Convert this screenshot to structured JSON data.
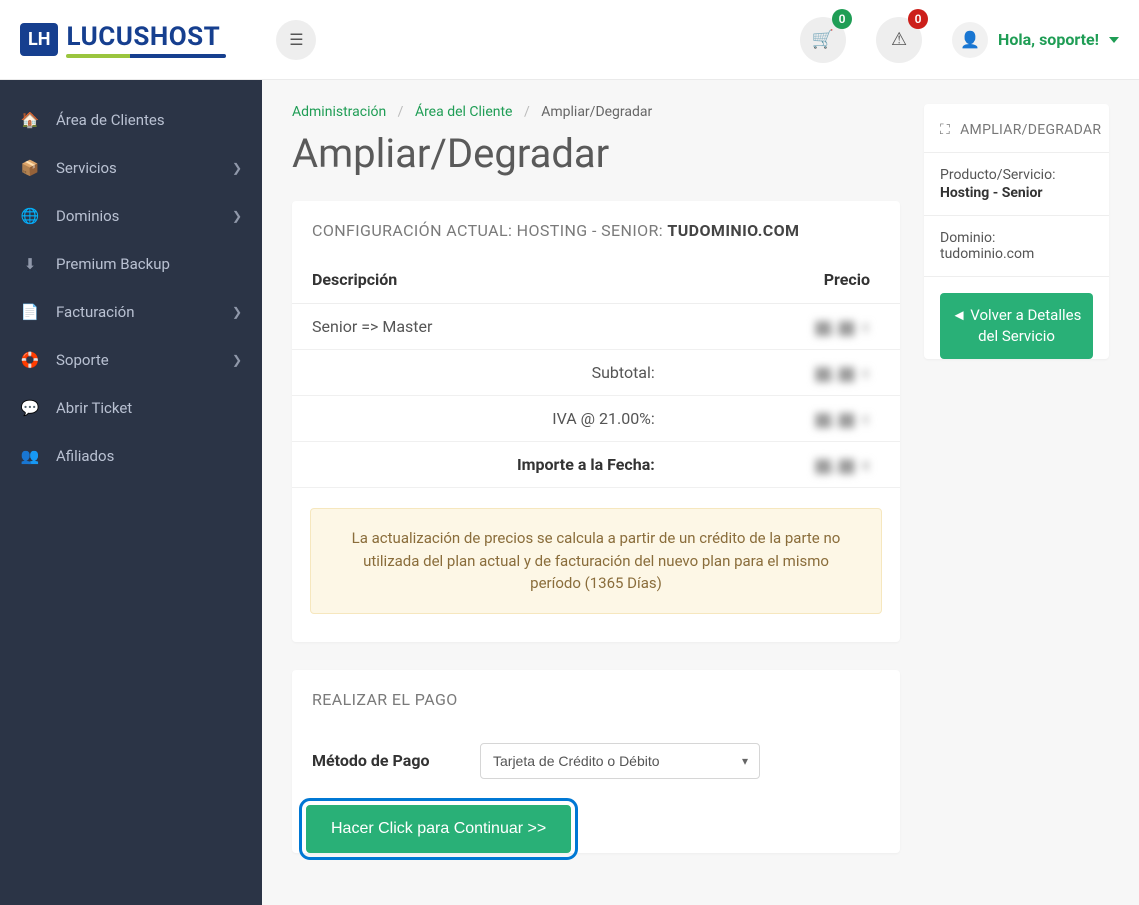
{
  "brand": {
    "badge": "LH",
    "name": "LUCUSHOST"
  },
  "topbar": {
    "cart_badge": "0",
    "alert_badge": "0",
    "greeting": "Hola, soporte!"
  },
  "sidebar": {
    "items": [
      {
        "icon": "🏠",
        "label": "Área de Clientes",
        "hasChildren": false
      },
      {
        "icon": "📦",
        "label": "Servicios",
        "hasChildren": true
      },
      {
        "icon": "🌐",
        "label": "Dominios",
        "hasChildren": true
      },
      {
        "icon": "⬇",
        "label": "Premium Backup",
        "hasChildren": false
      },
      {
        "icon": "📄",
        "label": "Facturación",
        "hasChildren": true
      },
      {
        "icon": "🛟",
        "label": "Soporte",
        "hasChildren": true
      },
      {
        "icon": "💬",
        "label": "Abrir Ticket",
        "hasChildren": false
      },
      {
        "icon": "👥",
        "label": "Afiliados",
        "hasChildren": false
      }
    ]
  },
  "breadcrumb": {
    "items": [
      "Administración",
      "Área del Cliente",
      "Ampliar/Degradar"
    ]
  },
  "page": {
    "title": "Ampliar/Degradar"
  },
  "config_panel": {
    "header_prefix": "CONFIGURACIÓN ACTUAL: HOSTING - SENIOR: ",
    "header_domain": "TUDOMINIO.COM",
    "columns": {
      "desc": "Descripción",
      "price": "Precio"
    },
    "rows": [
      {
        "desc": "Senior => Master",
        "price": "██,██ €"
      }
    ],
    "subtotal_label": "Subtotal:",
    "subtotal_value": "██,██ €",
    "tax_label": "IVA @ 21.00%:",
    "tax_value": "██,██ €",
    "total_label": "Importe a la Fecha:",
    "total_value": "██,██ €",
    "alert": "La actualización de precios se calcula a partir de un crédito de la parte no utilizada del plan actual y de facturación del nuevo plan para el mismo período (1365 Días)"
  },
  "payment_panel": {
    "header": "REALIZAR EL PAGO",
    "method_label": "Método de Pago",
    "method_selected": "Tarjeta de Crédito o Débito",
    "continue": "Hacer Click para Continuar >>"
  },
  "side_panel": {
    "title": "AMPLIAR/DEGRADAR",
    "product_label": "Producto/Servicio:",
    "product_value": "Hosting - Senior",
    "domain_label": "Dominio:",
    "domain_value": "tudominio.com",
    "back_button": "Volver a Detalles del Servicio"
  }
}
